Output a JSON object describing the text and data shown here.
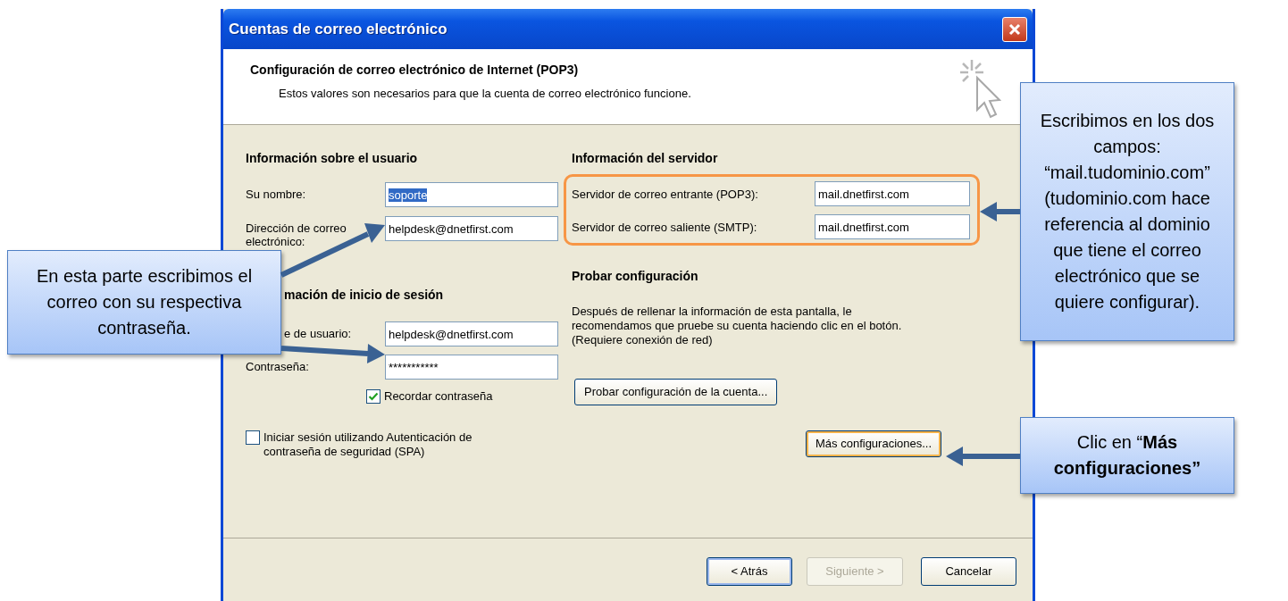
{
  "window": {
    "title": "Cuentas de correo electrónico"
  },
  "header": {
    "title": "Configuración de correo electrónico de Internet (POP3)",
    "subtitle": "Estos valores son necesarios para que la cuenta de correo electrónico funcione."
  },
  "user_info": {
    "heading": "Información sobre el usuario",
    "fields": [
      {
        "label": "Su nombre:",
        "value": "soporte",
        "selected": true
      },
      {
        "label": "Dirección de correo electrónico:",
        "value": "helpdesk@dnetfirst.com",
        "selected": false
      }
    ]
  },
  "login_info": {
    "heading": "mación de inicio de sesión",
    "fields": [
      {
        "label": "e de usuario:",
        "value": "helpdesk@dnetfirst.com",
        "selected": false
      },
      {
        "label": "Contraseña:",
        "value": "***********",
        "selected": false
      }
    ],
    "remember": {
      "label": "Recordar contraseña",
      "checked": true
    }
  },
  "spa": {
    "label": "Iniciar sesión utilizando Autenticación de contraseña de seguridad (SPA)",
    "checked": false
  },
  "server_info": {
    "heading": "Información del servidor",
    "highlighted": true,
    "fields": [
      {
        "label": "Servidor de correo entrante (POP3):",
        "value": "mail.dnetfirst.com",
        "selected": false
      },
      {
        "label": "Servidor de correo saliente (SMTP):",
        "value": "mail.dnetfirst.com",
        "selected": false
      }
    ]
  },
  "test": {
    "heading": "Probar configuración",
    "text": "Después de rellenar la información de esta pantalla, le recomendamos que pruebe su cuenta haciendo clic en el botón. (Requiere conexión de red)",
    "button": "Probar configuración de la cuenta..."
  },
  "more_button": {
    "label": "Más configuraciones...",
    "focused": true
  },
  "buttons": [
    {
      "label": "< Atrás",
      "disabled": false,
      "default": true
    },
    {
      "label": "Siguiente >",
      "disabled": true,
      "default": false
    },
    {
      "label": "Cancelar",
      "disabled": false,
      "default": false
    }
  ],
  "callouts": [
    {
      "text": "En esta parte escribimos el correo con su respectiva contraseña."
    },
    {
      "text": "Escribimos en los dos campos: “mail.tudominio.com” (tudominio.com hace referencia al dominio que tiene el correo electrónico que se quiere configurar)."
    },
    {
      "text": "Clic en “**Más configuraciones”**"
    }
  ]
}
